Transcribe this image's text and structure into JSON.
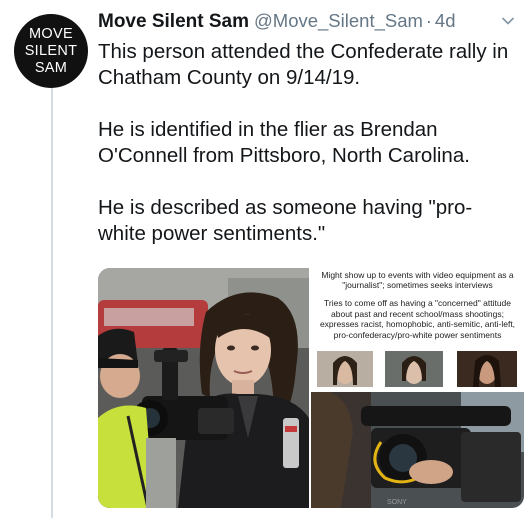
{
  "tweet": {
    "avatar_lines": [
      "MOVE",
      "SILENT",
      "SAM"
    ],
    "display_name": "Move Silent Sam",
    "handle": "@Move_Silent_Sam",
    "separator": "·",
    "time": "4d",
    "paragraphs": [
      "This person attended the Confederate rally in Chatham County on 9/14/19.",
      "He is identified in the flier as Brendan O'Connell from Pittsboro, North Carolina.",
      "He is described as someone having \"pro-white power sentiments.\""
    ]
  },
  "flier": {
    "top_text": "Might show up to events with video equipment as a \"journalist\"; sometimes seeks interviews",
    "main_text": "Tries to come off as having a \"concerned\" attitude about past and recent school/mass shootings; expresses racist, homophobic, anti-semitic, anti-left, pro-confederacy/pro-white power sentiments",
    "camera_brand": "SONY"
  },
  "icons": {
    "menu": "chevron-down-icon"
  },
  "colors": {
    "text": "#14171a",
    "secondary": "#657786",
    "avatar_bg": "#111111",
    "thread_line": "#d7dce0"
  }
}
